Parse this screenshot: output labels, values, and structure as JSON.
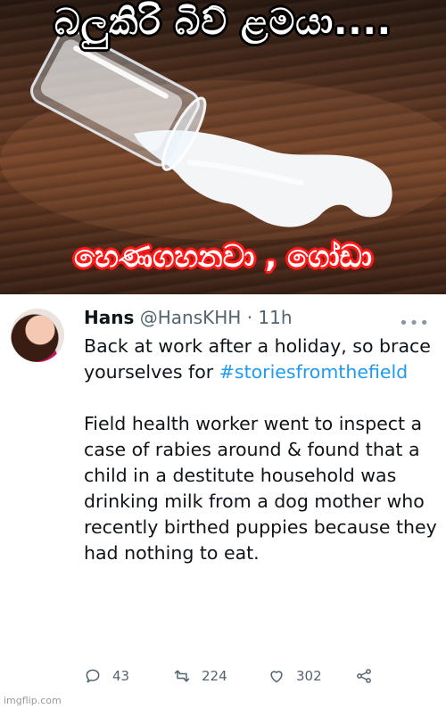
{
  "meme": {
    "top_caption": "බලුකිරි බිව් ළමයා....",
    "bottom_caption": "හෙණගහනවා , ගෝඩා",
    "scene": "spilled-milk-glass-image"
  },
  "tweet": {
    "display_name": "Hans",
    "handle": "@HansKHH",
    "separator": "·",
    "time": "11h",
    "more_icon": "more-dots-icon",
    "line1": "Back at work after a holiday, so brace yourselves for",
    "hashtag": "#storiesfromthefield",
    "paragraph2": "Field health worker went to inspect a case of rabies around & found that a child in  a destitute household was drinking milk from a dog mother who recently birthed puppies because they had nothing to eat.",
    "actions": {
      "replies": "43",
      "retweets": "224",
      "likes": "302"
    }
  },
  "watermark": "imgflip.com",
  "colors": {
    "link": "#1d9bf0",
    "text": "#0f1419",
    "muted": "#536471",
    "bottom_caption_glow": "#ff1a1a"
  }
}
